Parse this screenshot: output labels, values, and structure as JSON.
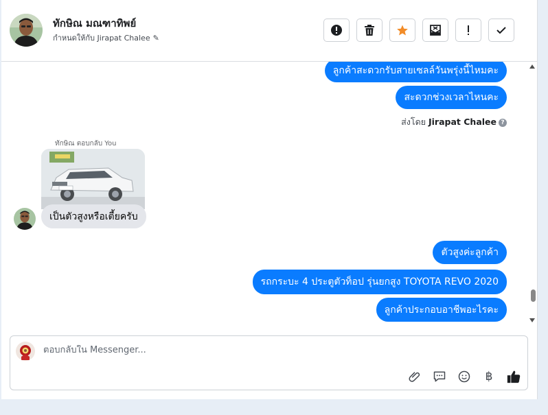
{
  "header": {
    "customer_name": "ทักษิณ มณฑาทิพย์",
    "assigned_label": "กำหนดให้กับ Jirapat Chalee",
    "pencil_glyph": "✎"
  },
  "actions": [
    {
      "name": "mark-spam-button",
      "icon": "alert-circle-icon"
    },
    {
      "name": "delete-button",
      "icon": "trash-icon"
    },
    {
      "name": "star-button",
      "icon": "star-icon",
      "color": "#f28c28"
    },
    {
      "name": "move-to-inbox-button",
      "icon": "envelope-x-icon"
    },
    {
      "name": "follow-up-button",
      "icon": "exclamation-icon"
    },
    {
      "name": "mark-done-button",
      "icon": "checkmark-icon"
    }
  ],
  "conversation": {
    "earlier_outgoing": [
      "ลูกค้าสะดวกรับสายเซลล์วันพรุ่งนี้ไหมคะ",
      "สะดวกช่วงเวลาไหนคะ"
    ],
    "sent_by": {
      "prefix": "ส่งโดย",
      "agent": "Jirapat Chalee",
      "help_glyph": "?"
    },
    "reply_label": "ทักษิณ ตอบกลับ You",
    "incoming_message": "เป็นตัวสูงหรือเตี้ยครับ",
    "later_outgoing": [
      "ตัวสูงค่ะลูกค้า",
      "รถกระบะ 4 ประตูตัวท็อป รุ่นยกสูง TOYOTA REVO 2020",
      "ลูกค้าประกอบอาชีพอะไรคะ"
    ]
  },
  "composer": {
    "placeholder": "ตอบกลับใน Messenger...",
    "value": "",
    "tools": [
      "paperclip-icon",
      "saved-reply-icon",
      "emoji-icon",
      "baht-icon",
      "thumbs-up-icon"
    ],
    "baht_glyph": "฿"
  },
  "colors": {
    "outgoing_bubble": "#0a7cff",
    "incoming_bubble": "#e4e6eb",
    "star": "#f28c28"
  }
}
